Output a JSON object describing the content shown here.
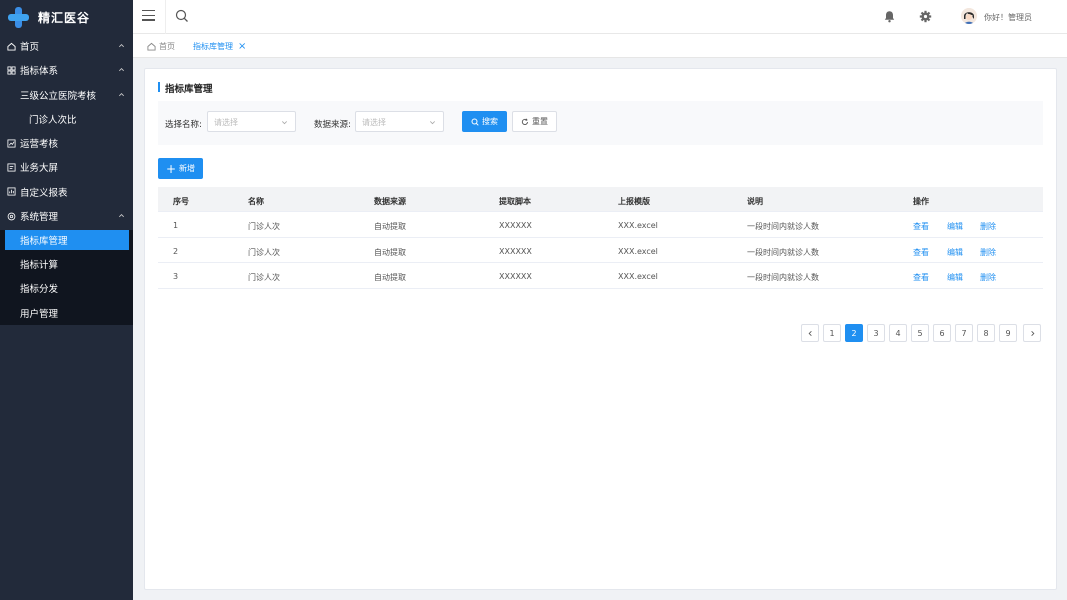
{
  "app": {
    "name": "精汇医谷",
    "brand_color": "#1f8ff1",
    "sidebar_bg": "#222a3a"
  },
  "sidebar": {
    "items": [
      {
        "label": "首页",
        "icon": "home-icon"
      },
      {
        "label": "指标体系",
        "icon": "grid-icon"
      },
      {
        "label": "三级公立医院考核"
      },
      {
        "label": "门诊人次比"
      },
      {
        "label": "运营考核",
        "icon": "chart-icon"
      },
      {
        "label": "业务大屏",
        "icon": "screen-icon"
      },
      {
        "label": "自定义报表",
        "icon": "report-icon"
      },
      {
        "label": "系统管理",
        "icon": "settings-icon"
      },
      {
        "label": "指标库管理"
      },
      {
        "label": "指标计算"
      },
      {
        "label": "指标分发"
      },
      {
        "label": "用户管理"
      }
    ]
  },
  "header": {
    "greeting": "你好！管理员"
  },
  "tags": {
    "home": "首页",
    "active": "指标库管理"
  },
  "page": {
    "title": "指标库管理",
    "filter": {
      "name_label": "选择名称:",
      "name_placeholder": "请选择",
      "source_label": "数据来源:",
      "source_placeholder": "请选择",
      "search_label": "搜索",
      "reset_label": "重置"
    },
    "add_label": "新增"
  },
  "table": {
    "headers": [
      "序号",
      "名称",
      "数据来源",
      "提取脚本",
      "上报模版",
      "说明",
      "操作"
    ],
    "rows": [
      {
        "no": "1",
        "name": "门诊人次",
        "source": "自动提取",
        "script": "XXXXXX",
        "template": "XXX.excel",
        "desc": "一段时间内就诊人数"
      },
      {
        "no": "2",
        "name": "门诊人次",
        "source": "自动提取",
        "script": "XXXXXX",
        "template": "XXX.excel",
        "desc": "一段时间内就诊人数"
      },
      {
        "no": "3",
        "name": "门诊人次",
        "source": "自动提取",
        "script": "XXXXXX",
        "template": "XXX.excel",
        "desc": "一段时间内就诊人数"
      }
    ],
    "actions": {
      "view": "查看",
      "edit": "编辑",
      "delete": "删除"
    }
  },
  "pagination": {
    "pages": [
      "1",
      "2",
      "3",
      "4",
      "5",
      "6",
      "7",
      "8",
      "9"
    ],
    "current": "2"
  }
}
